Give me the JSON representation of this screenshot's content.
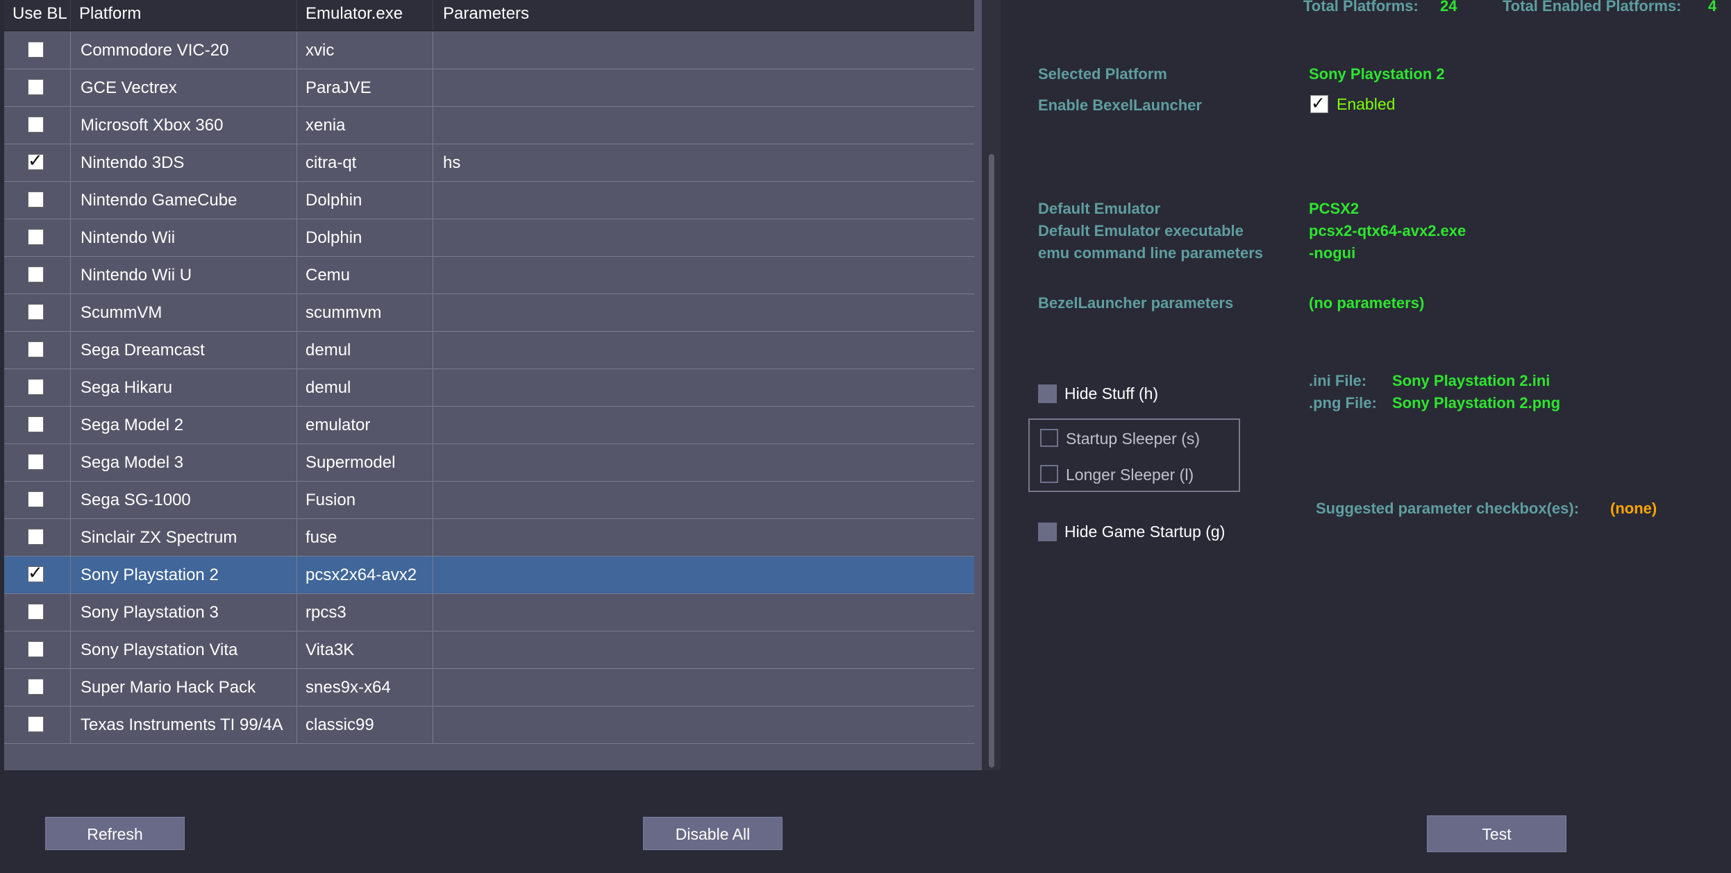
{
  "grid": {
    "headers": [
      "Use BL",
      "Platform",
      "Emulator.exe",
      "Parameters"
    ],
    "rows": [
      {
        "checked": false,
        "platform": "Commodore VIC-20",
        "emulator": "xvic",
        "params": ""
      },
      {
        "checked": false,
        "platform": "GCE Vectrex",
        "emulator": "ParaJVE",
        "params": ""
      },
      {
        "checked": false,
        "platform": "Microsoft Xbox 360",
        "emulator": "xenia",
        "params": ""
      },
      {
        "checked": true,
        "platform": "Nintendo 3DS",
        "emulator": "citra-qt",
        "params": "hs"
      },
      {
        "checked": false,
        "platform": "Nintendo GameCube",
        "emulator": "Dolphin",
        "params": ""
      },
      {
        "checked": false,
        "platform": "Nintendo Wii",
        "emulator": "Dolphin",
        "params": ""
      },
      {
        "checked": false,
        "platform": "Nintendo Wii U",
        "emulator": "Cemu",
        "params": ""
      },
      {
        "checked": false,
        "platform": "ScummVM",
        "emulator": "scummvm",
        "params": ""
      },
      {
        "checked": false,
        "platform": "Sega Dreamcast",
        "emulator": "demul",
        "params": ""
      },
      {
        "checked": false,
        "platform": "Sega Hikaru",
        "emulator": "demul",
        "params": ""
      },
      {
        "checked": false,
        "platform": "Sega Model 2",
        "emulator": "emulator",
        "params": ""
      },
      {
        "checked": false,
        "platform": "Sega Model 3",
        "emulator": "Supermodel",
        "params": ""
      },
      {
        "checked": false,
        "platform": "Sega SG-1000",
        "emulator": "Fusion",
        "params": ""
      },
      {
        "checked": false,
        "platform": "Sinclair ZX Spectrum",
        "emulator": "fuse",
        "params": ""
      },
      {
        "checked": true,
        "platform": "Sony Playstation 2",
        "emulator": "pcsx2x64-avx2",
        "params": "",
        "selected": true
      },
      {
        "checked": false,
        "platform": "Sony Playstation 3",
        "emulator": "rpcs3",
        "params": ""
      },
      {
        "checked": false,
        "platform": "Sony Playstation Vita",
        "emulator": "Vita3K",
        "params": ""
      },
      {
        "checked": false,
        "platform": "Super Mario Hack Pack",
        "emulator": "snes9x-x64",
        "params": ""
      },
      {
        "checked": false,
        "platform": "Texas Instruments TI 99/4A",
        "emulator": "classic99",
        "params": ""
      }
    ]
  },
  "totals": {
    "platforms_label": "Total Platforms:",
    "platforms_value": "24",
    "enabled_label": "Total Enabled Platforms:",
    "enabled_value": "4"
  },
  "details": {
    "selected_platform_label": "Selected Platform",
    "selected_platform_value": "Sony Playstation 2",
    "enable_label": "Enable BexelLauncher",
    "enabled_text": "Enabled",
    "enabled_checked": true,
    "default_emulator_label": "Default Emulator",
    "default_emulator_value": "PCSX2",
    "default_exe_label": "Default Emulator executable",
    "default_exe_value": "pcsx2-qtx64-avx2.exe",
    "emu_params_label": "emu command line parameters",
    "emu_params_value": "-nogui",
    "bl_params_label": "BezelLauncher parameters",
    "bl_params_value": "(no parameters)",
    "ini_label": ".ini File:",
    "ini_value": "Sony Playstation 2.ini",
    "png_label": ".png File:",
    "png_value": "Sony Playstation 2.png",
    "suggested_label": "Suggested parameter checkbox(es):",
    "suggested_value": "(none)"
  },
  "options": {
    "hide_stuff": "Hide Stuff (h)",
    "startup_sleeper": "Startup Sleeper (s)",
    "longer_sleeper": "Longer Sleeper (l)",
    "hide_game_startup": "Hide Game Startup (g)"
  },
  "buttons": {
    "refresh": "Refresh",
    "disable_all": "Disable All",
    "test": "Test"
  },
  "colors": {
    "label": "#5f9ea0",
    "value": "#2ee52e",
    "accent_orange": "#ffa500",
    "selected_row": "#40669a"
  }
}
